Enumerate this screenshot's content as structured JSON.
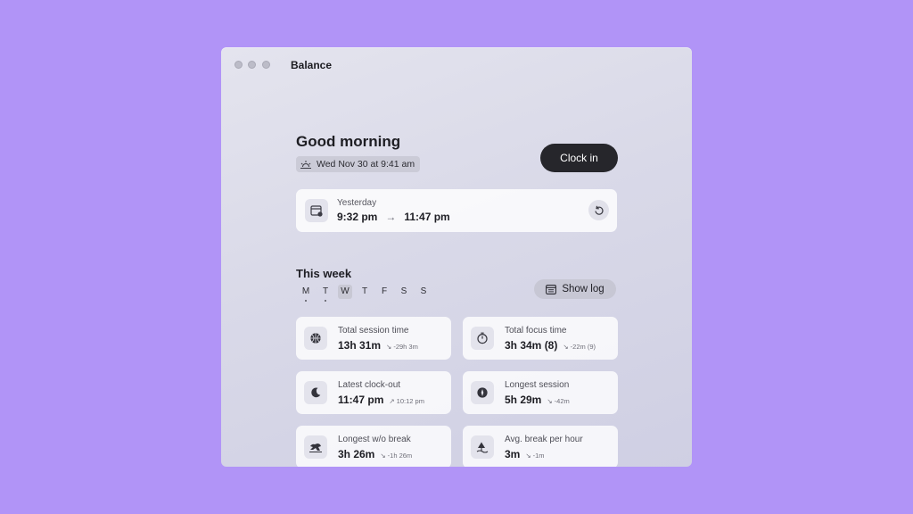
{
  "window": {
    "title": "Balance"
  },
  "greeting": "Good morning",
  "date_badge": {
    "icon": "sunrise-icon",
    "text": "Wed Nov 30 at 9:41 am"
  },
  "clock_in_label": "Clock in",
  "yesterday": {
    "label": "Yesterday",
    "start": "9:32 pm",
    "arrow": "→",
    "end": "11:47 pm"
  },
  "week": {
    "title": "This week",
    "days": [
      {
        "letter": "M",
        "marked": true
      },
      {
        "letter": "T",
        "marked": true
      },
      {
        "letter": "W",
        "today": true
      },
      {
        "letter": "T"
      },
      {
        "letter": "F"
      },
      {
        "letter": "S"
      },
      {
        "letter": "S"
      }
    ],
    "show_log_label": "Show log"
  },
  "stats": [
    {
      "label": "Total session time",
      "value": "13h 31m",
      "trend": "down",
      "delta": "-29h 3m",
      "icon": "basketball-icon"
    },
    {
      "label": "Total focus time",
      "value": "3h 34m (8)",
      "trend": "down",
      "delta": "-22m (9)",
      "icon": "timer-icon"
    },
    {
      "label": "Latest clock-out",
      "value": "11:47 pm",
      "trend": "up",
      "delta": "10:12 pm",
      "icon": "moon-icon"
    },
    {
      "label": "Longest session",
      "value": "5h 29m",
      "trend": "down",
      "delta": "-42m",
      "icon": "compass-icon"
    },
    {
      "label": "Longest w/o break",
      "value": "3h 26m",
      "trend": "down",
      "delta": "-1h 26m",
      "icon": "running-icon"
    },
    {
      "label": "Avg. break per hour",
      "value": "3m",
      "trend": "down",
      "delta": "-1m",
      "icon": "beach-icon"
    }
  ],
  "trend_glyphs": {
    "down": "↘",
    "up": "↗"
  },
  "colors": {
    "background": "#b194f7",
    "window": "#dcdce9",
    "primary_button": "#26262b"
  }
}
